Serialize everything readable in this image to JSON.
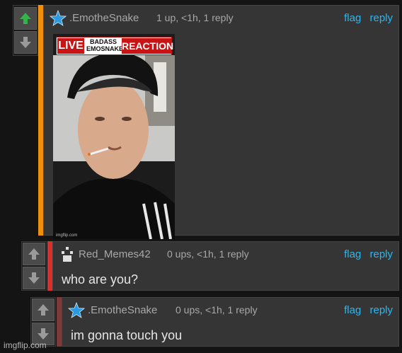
{
  "colors": {
    "link": "#2eb7ee",
    "upvoted": "#35b24a",
    "bar_orange": "#f08f0b",
    "bar_red": "#d9302b",
    "bar_dark": "#7a3a3a"
  },
  "actions": {
    "flag": "flag",
    "reply": "reply"
  },
  "comments": [
    {
      "username": ".EmotheSnake",
      "meta": "1 up, <1h, 1 reply",
      "user_icon": "star-icon",
      "upvoted": true,
      "text": "",
      "image": {
        "banner_left": "LIVE",
        "banner_middle": "BADASS EMOSNAKE",
        "banner_right": "REACTION",
        "watermark": "imgflip.com"
      }
    },
    {
      "username": "Red_Memes42",
      "meta": "0 ups, <1h, 1 reply",
      "user_icon": "anonymous-avatar-icon",
      "upvoted": false,
      "text": "who are you?"
    },
    {
      "username": ".EmotheSnake",
      "meta": "0 ups, <1h, 1 reply",
      "user_icon": "star-icon",
      "upvoted": false,
      "text": "im gonna touch you"
    }
  ],
  "site_watermark": "imgflip.com"
}
